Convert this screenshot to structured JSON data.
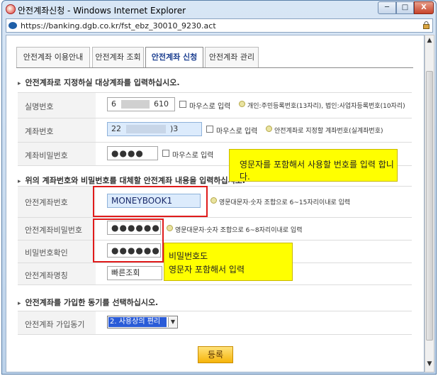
{
  "window": {
    "title": "안전계좌신청 - Windows Internet Explorer",
    "minimize": "─",
    "maximize": "□",
    "close": "X"
  },
  "address": {
    "url": "https://banking.dgb.co.kr/fst_ebz_30010_9230.act"
  },
  "tabs": [
    "안전계좌 이용안내",
    "안전계좌 조회",
    "안전계좌 신청",
    "안전계좌 관리"
  ],
  "sections": {
    "target": "안전계좌로 지정하실 대상계좌를 입력하십시오.",
    "replace": "위의 계좌번호와 비밀번호를 대체할 안전계좌 내용을 입력하십시오.",
    "motive": "안전계좌를 가입한 동기를 선택하십시오."
  },
  "form": {
    "realname": {
      "label": "실명번호",
      "value_a": "6",
      "value_b": "610",
      "mouse": "마우스로 입력",
      "hint": "개인:주민등록번호(13자리), 법인:사업자등록번호(10자리)"
    },
    "account": {
      "label": "계좌번호",
      "value_a": "22",
      "value_b": ")3",
      "mouse": "마우스로 입력",
      "hint": "안전계좌로 지정할 계좌번호(실계좌번호)"
    },
    "account_pw": {
      "label": "계좌비밀번호",
      "value": "●●●●",
      "mouse": "마우스로 입력"
    },
    "safe_account": {
      "label": "안전계좌번호",
      "value": "MONEYBOOK1",
      "hint": "영문대문자·숫자 조합으로 6~15자리이내로 입력"
    },
    "safe_pw": {
      "label": "안전계좌비밀번호",
      "value": "●●●●●●",
      "hint": "영문대문자·숫자 조합으로 6~8자리이내로 입력"
    },
    "pw_confirm": {
      "label": "비밀번호확인",
      "value": "●●●●●●"
    },
    "safe_name": {
      "label": "안전계좌명칭",
      "value": "빠른조회"
    },
    "motive": {
      "label": "안전계좌 가입동기",
      "selected": "2. 사용상의 편리"
    }
  },
  "notes": {
    "note1": "영문자를 포함해서 사용할 번호를 입력 합니다.",
    "note2_line1": "비밀번호도",
    "note2_line2": "영문자 포함해서 입력"
  },
  "submit": {
    "label": "등록"
  },
  "colors": {
    "accent": "#1a3d8f",
    "highlight": "#ffff00",
    "annotation": "#e01b1b"
  }
}
